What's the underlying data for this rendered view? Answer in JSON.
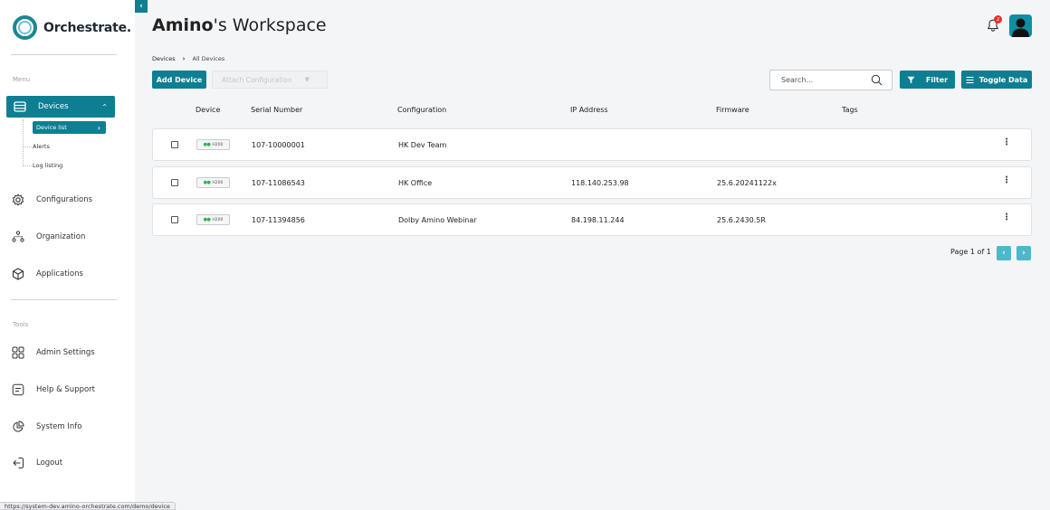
{
  "brand": {
    "name": "Orchestrate."
  },
  "sidebar": {
    "menu_label": "Menu",
    "tools_label": "Tools",
    "devices": {
      "label": "Devices"
    },
    "device_sub": [
      {
        "label": "Device list"
      },
      {
        "label": "Alerts"
      },
      {
        "label": "Log listing"
      }
    ],
    "items": [
      {
        "label": "Configurations",
        "icon": "gear-icon"
      },
      {
        "label": "Organization",
        "icon": "org-icon"
      },
      {
        "label": "Applications",
        "icon": "cube-icon"
      }
    ],
    "tools": [
      {
        "label": "Admin Settings",
        "icon": "grid-icon"
      },
      {
        "label": "Help & Support",
        "icon": "help-icon"
      },
      {
        "label": "System Info",
        "icon": "pie-icon"
      },
      {
        "label": "Logout",
        "icon": "logout-icon"
      }
    ]
  },
  "header": {
    "title_bold": "Amino",
    "title_rest": "'s Workspace",
    "notification_count": "2"
  },
  "breadcrumb": {
    "root": "Devices",
    "current": "All Devices"
  },
  "toolbar": {
    "add_device": "Add Device",
    "attach_configuration": "Attach Configuration",
    "search_placeholder": "Search...",
    "filter": "Filter",
    "toggle_data": "Toggle Data"
  },
  "table": {
    "headers": {
      "device": "Device",
      "serial": "Serial Number",
      "configuration": "Configuration",
      "ip": "IP Address",
      "firmware": "Firmware",
      "tags": "Tags"
    },
    "rows": [
      {
        "device": "H200",
        "serial": "107-10000001",
        "configuration": "HK Dev Team",
        "ip": "",
        "firmware": "",
        "tags": ""
      },
      {
        "device": "H200",
        "serial": "107-11086543",
        "configuration": "HK Office",
        "ip": "118.140.253.98",
        "firmware": "25.6.20241122x",
        "tags": ""
      },
      {
        "device": "H200",
        "serial": "107-11394856",
        "configuration": "Dolby Amino Webinar",
        "ip": "84.198.11.244",
        "firmware": "25.6.2430.5R",
        "tags": ""
      }
    ]
  },
  "pagination": {
    "label": "Page 1 of 1"
  },
  "status_bar": {
    "url": "https://system-dev.amino-orchestrate.com/demo/device"
  },
  "colors": {
    "accent": "#0e7f92",
    "page_button": "#4db8c9",
    "badge_red": "#e0322b",
    "status_green": "#35b04b"
  }
}
